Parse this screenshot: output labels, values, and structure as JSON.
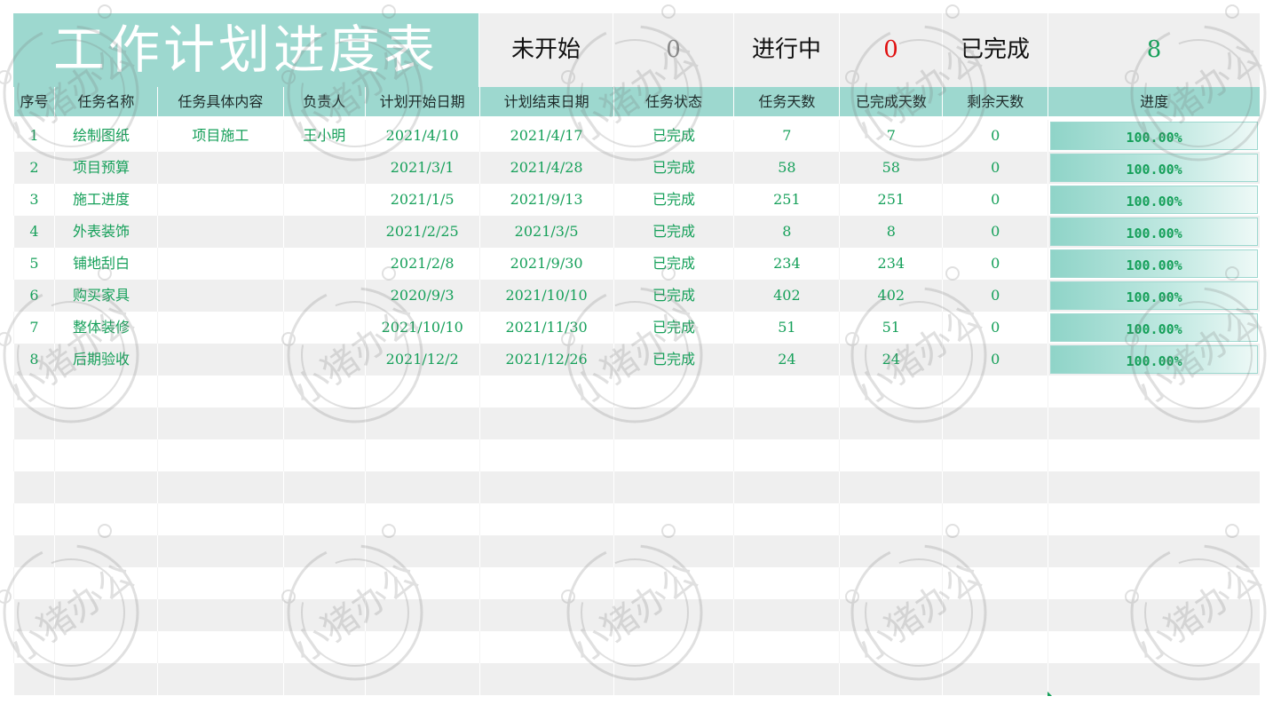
{
  "title": "工作计划进度表",
  "summary": [
    {
      "label": "未开始",
      "value": "0",
      "color": "#8a8a8a"
    },
    {
      "label": "进行中",
      "value": "0",
      "color": "#e01010"
    },
    {
      "label": "已完成",
      "value": "8",
      "color": "#16a05a"
    }
  ],
  "headers": [
    "序号",
    "任务名称",
    "任务具体内容",
    "负责人",
    "计划开始日期",
    "计划结束日期",
    "任务状态",
    "任务天数",
    "已完成天数",
    "剩余天数",
    "进度"
  ],
  "tasks": [
    {
      "no": "1",
      "name": "绘制图纸",
      "content": "项目施工",
      "owner": "王小明",
      "start": "2021/4/10",
      "end": "2021/4/17",
      "status": "已完成",
      "days": "7",
      "done": "7",
      "left": "0",
      "progress": "100.00%",
      "progress_value": 1.0
    },
    {
      "no": "2",
      "name": "项目预算",
      "content": "",
      "owner": "",
      "start": "2021/3/1",
      "end": "2021/4/28",
      "status": "已完成",
      "days": "58",
      "done": "58",
      "left": "0",
      "progress": "100.00%",
      "progress_value": 1.0
    },
    {
      "no": "3",
      "name": "施工进度",
      "content": "",
      "owner": "",
      "start": "2021/1/5",
      "end": "2021/9/13",
      "status": "已完成",
      "days": "251",
      "done": "251",
      "left": "0",
      "progress": "100.00%",
      "progress_value": 1.0
    },
    {
      "no": "4",
      "name": "外表装饰",
      "content": "",
      "owner": "",
      "start": "2021/2/25",
      "end": "2021/3/5",
      "status": "已完成",
      "days": "8",
      "done": "8",
      "left": "0",
      "progress": "100.00%",
      "progress_value": 1.0
    },
    {
      "no": "5",
      "name": "铺地刮白",
      "content": "",
      "owner": "",
      "start": "2021/2/8",
      "end": "2021/9/30",
      "status": "已完成",
      "days": "234",
      "done": "234",
      "left": "0",
      "progress": "100.00%",
      "progress_value": 1.0
    },
    {
      "no": "6",
      "name": "购买家具",
      "content": "",
      "owner": "",
      "start": "2020/9/3",
      "end": "2021/10/10",
      "status": "已完成",
      "days": "402",
      "done": "402",
      "left": "0",
      "progress": "100.00%",
      "progress_value": 1.0
    },
    {
      "no": "7",
      "name": "整体装修",
      "content": "",
      "owner": "",
      "start": "2021/10/10",
      "end": "2021/11/30",
      "status": "已完成",
      "days": "51",
      "done": "51",
      "left": "0",
      "progress": "100.00%",
      "progress_value": 1.0
    },
    {
      "no": "8",
      "name": "后期验收",
      "content": "",
      "owner": "",
      "start": "2021/12/2",
      "end": "2021/12/26",
      "status": "已完成",
      "days": "24",
      "done": "24",
      "left": "0",
      "progress": "100.00%",
      "progress_value": 1.0
    }
  ],
  "watermark_text": "小猪办公",
  "colors": {
    "accent": "#9dd8cf",
    "text_green": "#16a05a",
    "stripe": "#efefef"
  }
}
